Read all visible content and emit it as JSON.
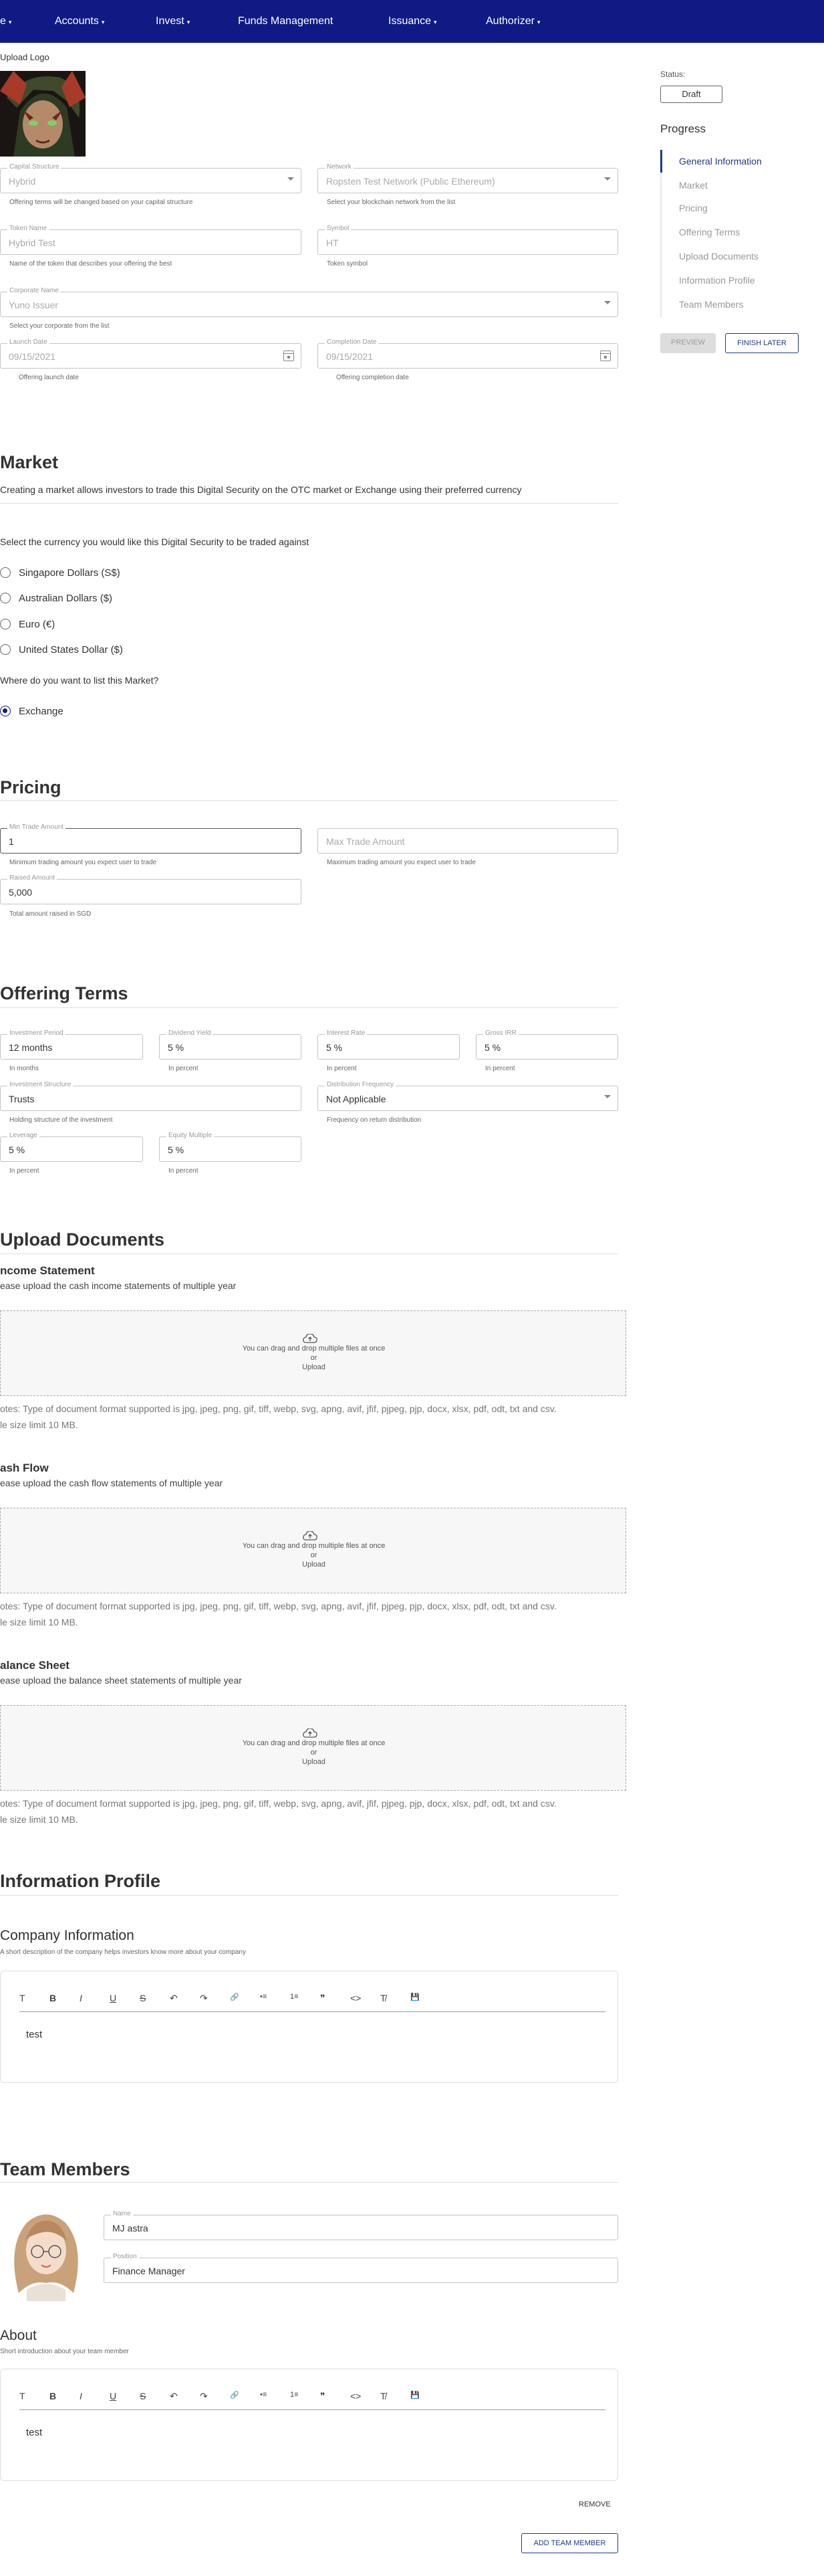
{
  "nav": {
    "items": [
      "e",
      "Accounts",
      "Invest",
      "Funds Management",
      "Issuance",
      "Authorizer"
    ]
  },
  "general": {
    "upload_logo": "Upload Logo",
    "capital_structure": {
      "label": "Capital Structure",
      "value": "Hybrid",
      "help": "Offering terms will be changed based on your capital structure"
    },
    "network": {
      "label": "Network",
      "value": "Ropsten Test Network (Public Ethereum)",
      "help": "Select your blockchain network from the list"
    },
    "token_name": {
      "label": "Token Name",
      "value": "Hybrid Test",
      "help": "Name of the token that describes your offering the best"
    },
    "symbol": {
      "label": "Symbol",
      "value": "HT",
      "help": "Token symbol"
    },
    "corporate_name": {
      "label": "Corporate Name",
      "value": "Yuno Issuer",
      "help": "Select your corporate from the list"
    },
    "launch_date": {
      "label": "Launch Date",
      "value": "09/15/2021",
      "help": "Offering launch date"
    },
    "completion_date": {
      "label": "Completion Date",
      "value": "09/15/2021",
      "help": "Offering completion date"
    }
  },
  "sidebar": {
    "status_label": "Status:",
    "status_value": "Draft",
    "progress_title": "Progress",
    "items": [
      "General Information",
      "Market",
      "Pricing",
      "Offering Terms",
      "Upload Documents",
      "Information Profile",
      "Team Members"
    ],
    "preview": "PREVIEW",
    "finish_later": "FINISH LATER"
  },
  "market": {
    "title": "Market",
    "description": "Creating a market allows investors to trade this Digital Security on the OTC market or Exchange using their preferred currency",
    "currency_question": "Select the currency you would like this Digital Security to be traded against",
    "currencies": [
      "Singapore Dollars (S$)",
      "Australian Dollars ($)",
      "Euro (€)",
      "United States Dollar ($)"
    ],
    "list_question": "Where do you want to list this Market?",
    "list_option": "Exchange"
  },
  "pricing": {
    "title": "Pricing",
    "min_trade": {
      "label": "Min Trade Amount",
      "value": "1",
      "help": "Minimum trading amount you expect user to trade"
    },
    "max_trade": {
      "placeholder": "Max Trade Amount",
      "help": "Maximum trading amount you expect user to trade"
    },
    "raised": {
      "label": "Raised Amount",
      "value": "5,000",
      "help": "Total amount raised in SGD"
    }
  },
  "terms": {
    "title": "Offering Terms",
    "investment_period": {
      "label": "Investment Period",
      "value": "12 months",
      "help": "In months"
    },
    "dividend_yield": {
      "label": "Dividend Yield",
      "value": "5 %",
      "help": "In percent"
    },
    "interest_rate": {
      "label": "Interest Rate",
      "value": "5 %",
      "help": "In percent"
    },
    "gross_irr": {
      "label": "Gross IRR",
      "value": "5 %",
      "help": "In percent"
    },
    "investment_structure": {
      "label": "Investment Structure",
      "value": "Trusts",
      "help": "Holding structure of the investment"
    },
    "distribution_frequency": {
      "label": "Distribution Frequency",
      "value": "Not Applicable",
      "help": "Frequency on return distribution"
    },
    "leverage": {
      "label": "Leverage",
      "value": "5 %",
      "help": "In percent"
    },
    "equity_multiple": {
      "label": "Equity Multiple",
      "value": "5 %",
      "help": "In percent"
    }
  },
  "documents": {
    "title": "Upload Documents",
    "drop_line1": "You can drag and drop multiple files at once",
    "drop_line2": "or",
    "drop_line3": "Upload",
    "note1": "otes: Type of document format supported is jpg, jpeg, png, gif, tiff, webp, svg, apng, avif, jfif, pjpeg, pjp, docx, xlsx, pdf, odt, txt and csv.",
    "note2": "le size limit 10 MB.",
    "items": [
      {
        "title": "ncome Statement",
        "subtitle": "ease upload the cash income statements of multiple year"
      },
      {
        "title": "ash Flow",
        "subtitle": "ease upload the cash flow statements of multiple year"
      },
      {
        "title": "alance Sheet",
        "subtitle": "ease upload the balance sheet statements of multiple year"
      }
    ]
  },
  "profile": {
    "title": "Information Profile",
    "company_title": "Company Information",
    "company_help": "A short description of the company helps investors know more about your company",
    "company_text": "test"
  },
  "team": {
    "title": "Team Members",
    "name": {
      "label": "Name",
      "value": "MJ astra"
    },
    "position": {
      "label": "Position",
      "value": "Finance Manager"
    },
    "about_title": "About",
    "about_help": "Short introduction about your team member",
    "about_text": "test",
    "remove": "REMOVE",
    "add_member": "ADD TEAM MEMBER"
  },
  "toolbar": [
    "T",
    "B",
    "I",
    "U",
    "S",
    "↶",
    "↷",
    "🔗",
    "•≡",
    "1≡",
    "❞",
    "<>",
    "T̸",
    "💾"
  ],
  "colors": {
    "nav": "#0f1a85",
    "accent": "#1e3a8a"
  }
}
